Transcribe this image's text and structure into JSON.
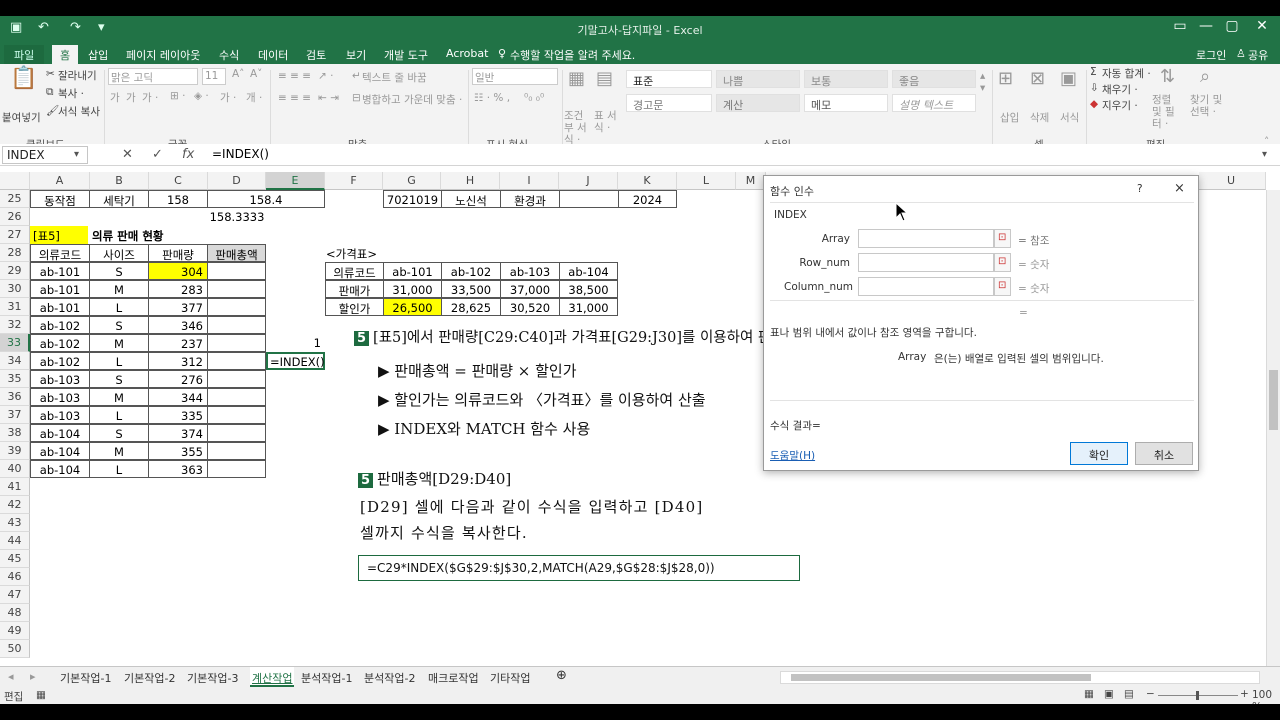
{
  "window": {
    "title": "기말고사-답지파일 - Excel"
  },
  "ribbon_tabs": [
    "파일",
    "홈",
    "삽입",
    "페이지 레이아웃",
    "수식",
    "데이터",
    "검토",
    "보기",
    "개발 도구",
    "Acrobat"
  ],
  "tell_me": "수행할 작업을 알려 주세요.",
  "account": {
    "login": "로그인",
    "share": "공유"
  },
  "ribbon": {
    "paste": "붙여넣기",
    "cut": "잘라내기",
    "copy": "복사 ·",
    "format_painter": "서식 복사",
    "clipboard": "클립보드",
    "font_name": "맑은 고딕",
    "font_size": "11",
    "font_group": "글꼴",
    "wrap_text": "텍스트 줄 바꿈",
    "merge_center": "병합하고 가운데 맞춤 ·",
    "align_group": "맞춤",
    "number_format": "일반",
    "number_group": "표시 형식",
    "cond_format": "조건부 서식 ·",
    "table_format": "표 서식 ·",
    "styles": [
      "표준",
      "나쁨",
      "보통",
      "좋음",
      "경고문",
      "계산",
      "메모",
      "설명 텍스트"
    ],
    "style_group": "스타일",
    "insert": "삽입",
    "delete": "삭제",
    "format": "서식",
    "cells_group": "셀",
    "autosum": "자동 합계 ·",
    "fill": "채우기 ·",
    "clear": "지우기 ·",
    "sort_filter": "정렬 및 필터 ·",
    "find_select": "찾기 및 선택 ·",
    "edit_group": "편집"
  },
  "formula_bar": {
    "name_box": "INDEX",
    "formula": "=INDEX()"
  },
  "columns": [
    "A",
    "B",
    "C",
    "D",
    "E",
    "F",
    "G",
    "H",
    "I",
    "J",
    "K",
    "L",
    "M",
    "U"
  ],
  "rows": [
    "25",
    "26",
    "27",
    "28",
    "29",
    "30",
    "31",
    "32",
    "33",
    "34",
    "35",
    "36",
    "37",
    "38",
    "39",
    "40",
    "41",
    "42",
    "43",
    "44",
    "45",
    "46",
    "47",
    "48",
    "49",
    "50"
  ],
  "sheet": {
    "r25": [
      "동작점",
      "세탁기",
      "158",
      "158.4"
    ],
    "r26_d": "158.3333",
    "r25_right": [
      "7021019",
      "노신석",
      "환경과",
      "",
      "2024"
    ],
    "t5_label": "[표5]",
    "t5_title": "의류 판매 현황",
    "t5_headers": [
      "의류코드",
      "사이즈",
      "판매량",
      "판매총액"
    ],
    "t5_rows": [
      [
        "ab-101",
        "S",
        "304"
      ],
      [
        "ab-101",
        "M",
        "283"
      ],
      [
        "ab-101",
        "L",
        "377"
      ],
      [
        "ab-102",
        "S",
        "346"
      ],
      [
        "ab-102",
        "M",
        "237"
      ],
      [
        "ab-102",
        "L",
        "312"
      ],
      [
        "ab-103",
        "S",
        "276"
      ],
      [
        "ab-103",
        "M",
        "344"
      ],
      [
        "ab-103",
        "L",
        "335"
      ],
      [
        "ab-104",
        "S",
        "374"
      ],
      [
        "ab-104",
        "M",
        "355"
      ],
      [
        "ab-104",
        "L",
        "363"
      ]
    ],
    "e32": "1",
    "e33": "=INDEX()",
    "price_title": "<가격표>",
    "price_headers": [
      "의류코드",
      "ab-101",
      "ab-102",
      "ab-103",
      "ab-104"
    ],
    "price_rows": [
      [
        "판매가",
        "31,000",
        "33,500",
        "37,000",
        "38,500"
      ],
      [
        "할인가",
        "26,500",
        "28,625",
        "30,520",
        "31,000"
      ]
    ]
  },
  "doc": {
    "badge": "5",
    "header": "[표5]에서 판매량[C29:C40]과 가격표[G29:J30]를 이용하여 판",
    "bullets": [
      "▶ 판매총액 = 판매량 × 할인가",
      "▶ 할인가는 의류코드와 〈가격표〉를 이용하여 산출",
      "▶ INDEX와 MATCH 함수 사용"
    ],
    "sub_header": "판매총액[D29:D40]",
    "body1": "[D29] 셀에 다음과 같이 수식을 입력하고 [D40]",
    "body2": "셀까지 수식을 복사한다.",
    "formula": "=C29*INDEX($G$29:$J$30,2,MATCH(A29,$G$28:$J$28,0))"
  },
  "dialog": {
    "title": "함수 인수",
    "help_q": "?",
    "close": "×",
    "func": "INDEX",
    "args": [
      {
        "name": "Array",
        "hint": "= 참조"
      },
      {
        "name": "Row_num",
        "hint": "= 숫자"
      },
      {
        "name": "Column_num",
        "hint": "= 숫자"
      }
    ],
    "eq": "=",
    "desc": "표나 범위 내에서 값이나 참조 영역을 구합니다.",
    "arg_desc_name": "Array",
    "arg_desc": "은(는) 배열로 입력된 셀의 범위입니다.",
    "result": "수식 결과=",
    "help_link": "도움말(H)",
    "ok": "확인",
    "cancel": "취소"
  },
  "sheet_tabs": [
    "기본작업-1",
    "기본작업-2",
    "기본작업-3",
    "계산작업",
    "분석작업-1",
    "분석작업-2",
    "매크로작업",
    "기타작업"
  ],
  "status": {
    "mode": "편집",
    "zoom": "100 %"
  },
  "colors": {
    "excel_green": "#217346",
    "highlight": "#ffff00"
  }
}
